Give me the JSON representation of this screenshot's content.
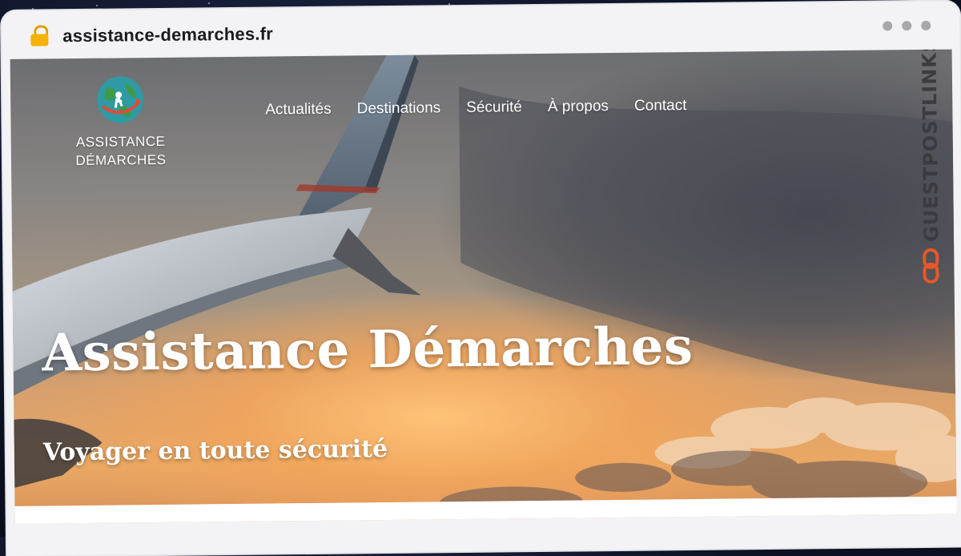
{
  "browser": {
    "url": "assistance-demarches.fr",
    "lock_icon": "lock-icon",
    "window_dots": 3
  },
  "site": {
    "logo": {
      "line1": "ASSISTANCE",
      "line2": "DÉMARCHES",
      "icon": "globe-traveler-icon"
    },
    "nav": [
      {
        "label": "Actualités"
      },
      {
        "label": "Destinations"
      },
      {
        "label": "Sécurité"
      },
      {
        "label": "À propos"
      },
      {
        "label": "Contact"
      }
    ],
    "hero": {
      "title": "Assistance Démarches",
      "subtitle": "Voyager en toute sécurité"
    }
  },
  "watermark": {
    "text": "GUESTPOSTLINKS",
    "icon": "chain-link-icon"
  },
  "colors": {
    "lock": "#f5b300",
    "watermark_accent": "#e8572a"
  }
}
